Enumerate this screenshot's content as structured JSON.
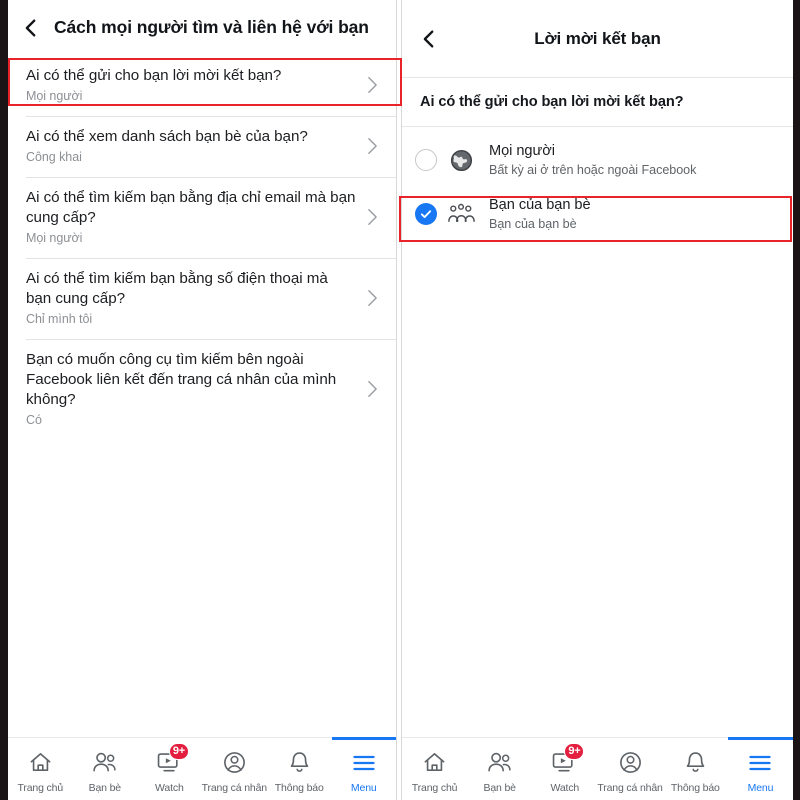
{
  "left_panel": {
    "header": {
      "back_icon": "chevron-left-icon",
      "title": "Cách mọi người tìm và liên hệ với bạn"
    },
    "settings": [
      {
        "title": "Ai có thể gửi cho bạn lời mời kết bạn?",
        "value": "Mọi người",
        "chevron": "chevron-right-icon",
        "highlighted": true
      },
      {
        "title": "Ai có thể xem danh sách bạn bè của bạn?",
        "value": "Công khai",
        "chevron": "chevron-right-icon",
        "highlighted": false
      },
      {
        "title": "Ai có thể tìm kiếm bạn bằng địa chỉ email mà bạn cung cấp?",
        "value": "Mọi người",
        "chevron": "chevron-right-icon",
        "highlighted": false
      },
      {
        "title": "Ai có thể tìm kiếm bạn bằng số điện thoại mà bạn cung cấp?",
        "value": "Chỉ mình tôi",
        "chevron": "chevron-right-icon",
        "highlighted": false
      },
      {
        "title": "Bạn có muốn công cụ tìm kiếm bên ngoài Facebook liên kết đến trang cá nhân của mình không?",
        "value": "Có",
        "chevron": "chevron-right-icon",
        "highlighted": false
      }
    ]
  },
  "right_panel": {
    "header": {
      "back_icon": "chevron-left-icon",
      "title": "Lời mời kết bạn"
    },
    "question": "Ai có thể gửi cho bạn lời mời kết bạn?",
    "options": [
      {
        "title": "Mọi người",
        "subtitle": "Bất kỳ ai ở trên hoặc ngoài Facebook",
        "icon": "globe-icon",
        "selected": false,
        "highlighted": false
      },
      {
        "title": "Bạn của bạn bè",
        "subtitle": "Bạn của bạn bè",
        "icon": "friends-group-icon",
        "selected": true,
        "highlighted": true
      }
    ]
  },
  "bottom_nav": {
    "items": [
      {
        "label": "Trang chủ",
        "icon": "home-icon",
        "badge": "",
        "active": false
      },
      {
        "label": "Bạn bè",
        "icon": "friends-icon",
        "badge": "",
        "active": false
      },
      {
        "label": "Watch",
        "icon": "watch-icon",
        "badge": "9+",
        "active": false
      },
      {
        "label": "Trang cá nhân",
        "icon": "profile-icon",
        "badge": "",
        "active": false
      },
      {
        "label": "Thông báo",
        "icon": "bell-icon",
        "badge": "",
        "active": false
      },
      {
        "label": "Menu",
        "icon": "hamburger-menu-icon",
        "badge": "",
        "active": true
      }
    ]
  },
  "colors": {
    "accent_blue": "#1877f2",
    "annotation_red": "#e8232a",
    "badge_red": "#e41e3f"
  }
}
